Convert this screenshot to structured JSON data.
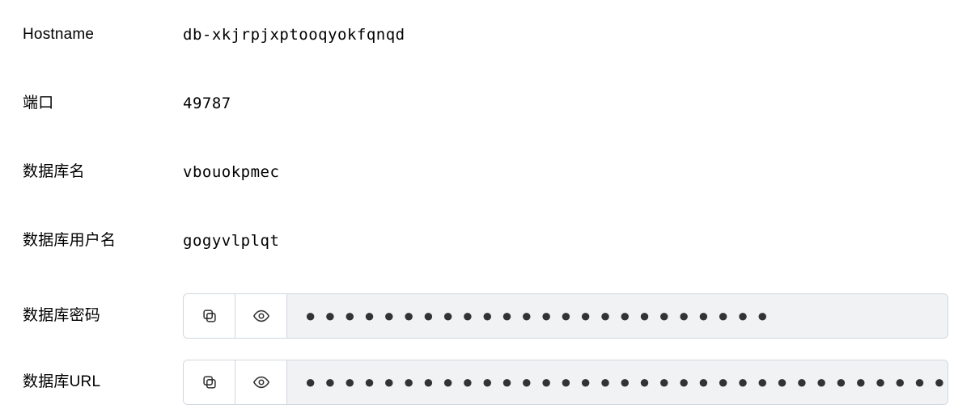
{
  "rows": {
    "hostname": {
      "label": "Hostname",
      "value": "db-xkjrpjxptooqyokfqnqd"
    },
    "port": {
      "label": "端口",
      "value": "49787"
    },
    "dbname": {
      "label": "数据库名",
      "value": "vbouokpmec"
    },
    "dbuser": {
      "label": "数据库用户名",
      "value": "gogyvlplqt"
    },
    "dbpass": {
      "label": "数据库密码",
      "masked": "●●●●●●●●●●●●●●●●●●●●●●●●"
    },
    "dburl": {
      "label": "数据库URL",
      "masked": "●●●●●●●●●●●●●●●●●●●●●●●●●●●●●●●●●●●●●●●●●●●●●●●●●●●●●"
    }
  }
}
